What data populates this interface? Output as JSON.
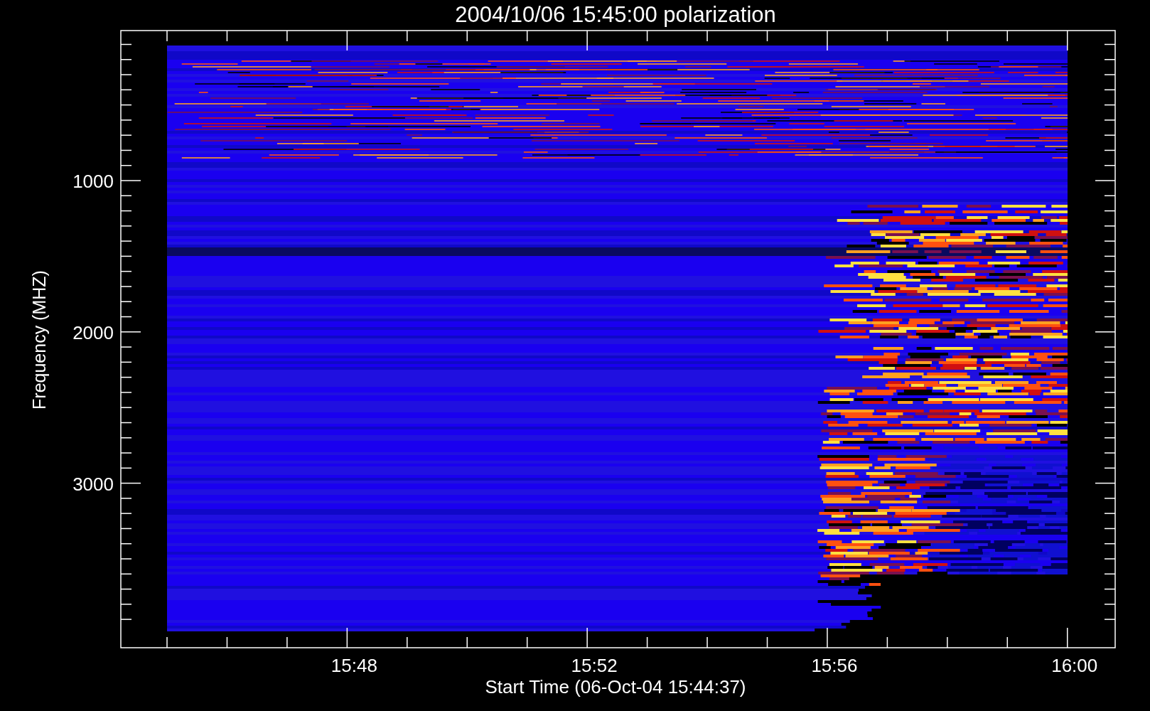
{
  "title": "2004/10/06 15:45:00 polarization",
  "y_axis": {
    "label": "Frequency (MHZ)",
    "ticks": [
      "1000",
      "2000",
      "3000"
    ]
  },
  "x_axis": {
    "label": "Start Time (06-Oct-04 15:44:37)",
    "ticks": [
      "15:48",
      "15:52",
      "15:56",
      "16:00"
    ]
  }
}
